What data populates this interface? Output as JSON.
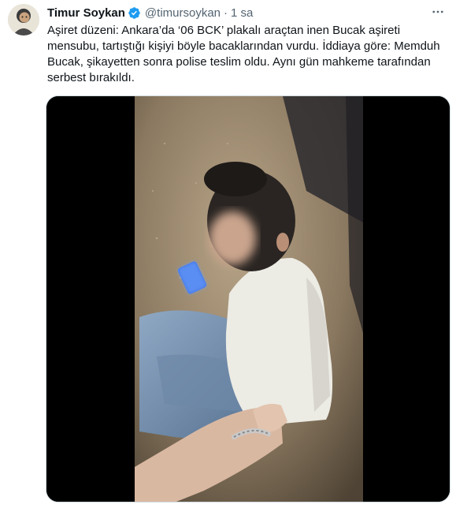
{
  "tweet": {
    "author_name": "Timur Soykan",
    "handle": "@timursoykan",
    "separator": "·",
    "time": "1 sa",
    "text": "Aşiret düzeni: Ankara’da ‘06 BCK’ plakalı araçtan inen Bucak aşireti mensubu, tartıştığı kişiyi böyle bacaklarından vurdu. İddiaya göre: Memduh Bucak, şikayetten sonra polise teslim oldu. Aynı gün mahkeme tarafından serbest bırakıldı.",
    "verified": true,
    "icons": {
      "verified": "verified-badge-icon",
      "more": "more-options-icon"
    },
    "colors": {
      "verified_blue": "#1d9bf0",
      "secondary_text": "#536471",
      "primary_text": "#0f1419"
    }
  }
}
